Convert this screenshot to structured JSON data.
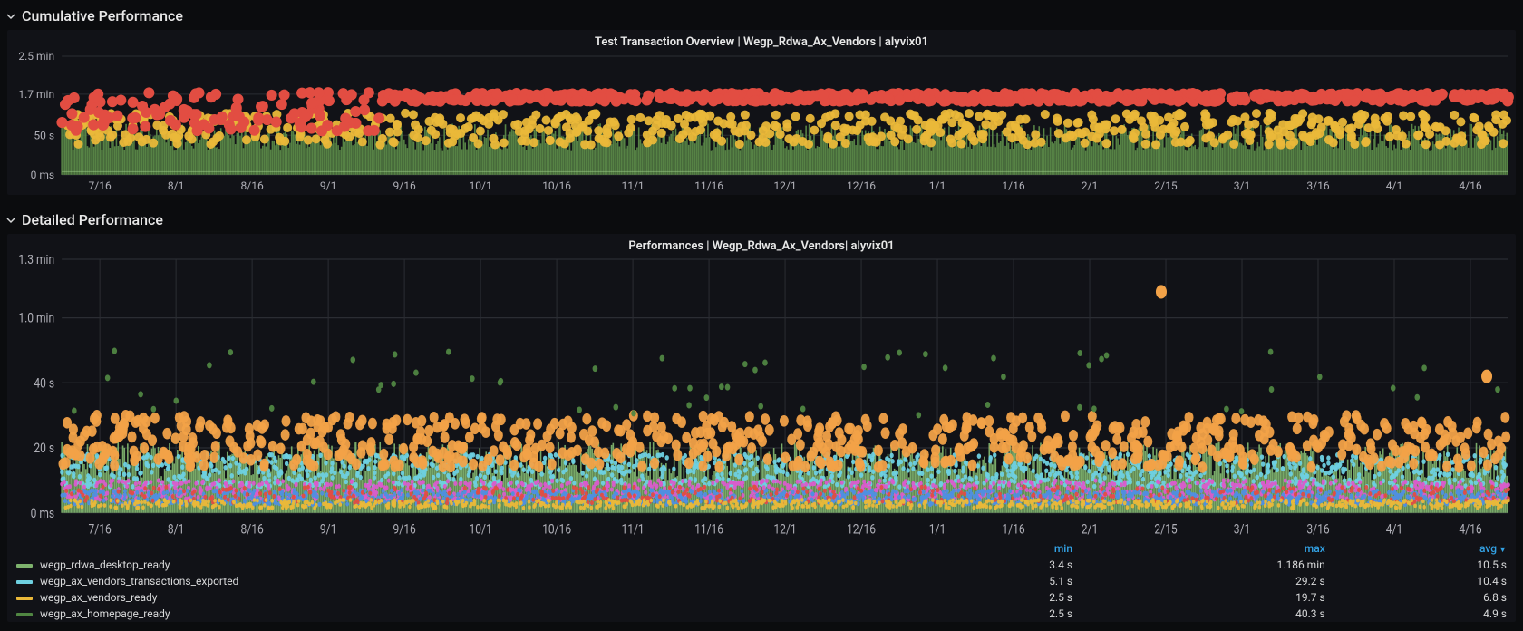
{
  "sections": {
    "cumulative": {
      "title": "Cumulative Performance"
    },
    "detailed": {
      "title": "Detailed Performance"
    }
  },
  "panel1": {
    "title": "Test Transaction Overview | Wegp_Rdwa_Ax_Vendors | alyvix01"
  },
  "panel2": {
    "title": "Performances | Wegp_Rdwa_Ax_Vendors| alyvix01",
    "stats_header": {
      "min": "min",
      "max": "max",
      "avg": "avg"
    },
    "legend": [
      {
        "name": "wegp_rdwa_desktop_ready",
        "color": "#7eb26d",
        "min": "3.4 s",
        "max": "1.186 min",
        "avg": "10.5 s"
      },
      {
        "name": "wegp_ax_vendors_transactions_exported",
        "color": "#6ed0e0",
        "min": "5.1 s",
        "max": "29.2 s",
        "avg": "10.4 s"
      },
      {
        "name": "wegp_ax_vendors_ready",
        "color": "#eab839",
        "min": "2.5 s",
        "max": "19.7 s",
        "avg": "6.8 s"
      },
      {
        "name": "wegp_ax_homepage_ready",
        "color": "#508642",
        "min": "2.5 s",
        "max": "40.3 s",
        "avg": "4.9 s"
      }
    ]
  },
  "x_ticks": [
    "7/16",
    "8/1",
    "8/16",
    "9/1",
    "9/16",
    "10/1",
    "10/16",
    "11/1",
    "11/16",
    "12/1",
    "12/16",
    "1/1",
    "1/16",
    "2/1",
    "2/15",
    "3/1",
    "3/16",
    "4/1",
    "4/16"
  ],
  "chart_data": [
    {
      "type": "scatter",
      "title": "Test Transaction Overview | Wegp_Rdwa_Ax_Vendors | alyvix01",
      "xlabel": "",
      "ylabel": "",
      "x_categories": [
        "7/16",
        "8/1",
        "8/16",
        "9/1",
        "9/16",
        "10/1",
        "10/16",
        "11/1",
        "11/16",
        "12/1",
        "12/16",
        "1/1",
        "1/16",
        "2/1",
        "2/15",
        "3/1",
        "3/16",
        "4/1",
        "4/16"
      ],
      "y_ticks": [
        "0 ms",
        "50 s",
        "1.7 min",
        "2.5 min"
      ],
      "ylim_seconds": [
        0,
        150
      ],
      "series": [
        {
          "name": "area-fill",
          "color": "#7eb26d",
          "render": "area",
          "note": "dense green area ~0–60 s across full range"
        },
        {
          "name": "warning-band",
          "color": "#eab839",
          "render": "points",
          "note": "yellow dots mostly 40–70 s across full range"
        },
        {
          "name": "critical-band",
          "color": "#e24d42",
          "render": "points",
          "note": "red dots clustered near ~100 s (≈1.7 min) from ~9/16 onward, sporadic before"
        }
      ]
    },
    {
      "type": "scatter",
      "title": "Performances | Wegp_Rdwa_Ax_Vendors| alyvix01",
      "xlabel": "",
      "ylabel": "",
      "x_categories": [
        "7/16",
        "8/1",
        "8/16",
        "9/1",
        "9/16",
        "10/1",
        "10/16",
        "11/1",
        "11/16",
        "12/1",
        "12/16",
        "1/1",
        "1/16",
        "2/1",
        "2/15",
        "3/1",
        "3/16",
        "4/1",
        "4/16"
      ],
      "y_ticks": [
        "0 ms",
        "20 s",
        "40 s",
        "1.0 min",
        "1.3 min"
      ],
      "ylim_seconds": [
        0,
        78
      ],
      "series": [
        {
          "name": "wegp_rdwa_desktop_ready",
          "color": "#7eb26d",
          "min_s": 3.4,
          "max_s": 71.2,
          "avg_s": 10.5
        },
        {
          "name": "wegp_ax_vendors_transactions_exported",
          "color": "#6ed0e0",
          "min_s": 5.1,
          "max_s": 29.2,
          "avg_s": 10.4
        },
        {
          "name": "wegp_ax_vendors_ready",
          "color": "#eab839",
          "min_s": 2.5,
          "max_s": 19.7,
          "avg_s": 6.8
        },
        {
          "name": "wegp_ax_homepage_ready",
          "color": "#508642",
          "min_s": 2.5,
          "max_s": 40.3,
          "avg_s": 4.9
        }
      ],
      "extra_series_visible": [
        {
          "color": "#f2a248",
          "note": "orange scatter dots ~15–30 s"
        },
        {
          "color": "#d95ccb",
          "note": "magenta band ~5–10 s"
        },
        {
          "color": "#4f8fe0",
          "note": "blue band ~3–8 s"
        },
        {
          "color": "#e24d42",
          "note": "occasional red low-band dots"
        }
      ]
    }
  ]
}
